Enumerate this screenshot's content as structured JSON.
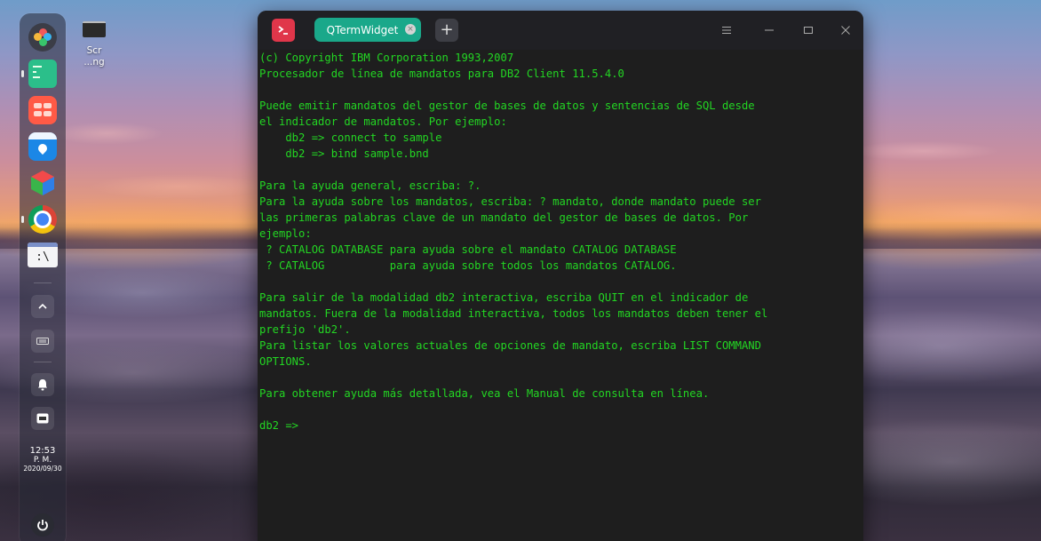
{
  "colors": {
    "terminal_text": "#23d623",
    "terminal_bg": "#1e1e1e",
    "tab_accent": "#1aa88a",
    "app_icon": "#e0364a"
  },
  "dock": {
    "icons": [
      "launcher-icon",
      "terminal-icon",
      "app-store-icon",
      "maps-icon",
      "cube-app-icon",
      "chrome-icon",
      "command-prompt-icon"
    ],
    "clock": {
      "time": "12:53",
      "period": "P. M.",
      "date": "2020/09/30"
    },
    "tray": [
      "chevron-up-icon",
      "keyboard-icon",
      "notification-bell-icon",
      "system-tray-icon"
    ],
    "power_icon": "power-icon"
  },
  "desktop": {
    "file_label_line1": "Scr",
    "file_label_line2": "...ng"
  },
  "window": {
    "app_icon": "terminal-prompt-icon",
    "tab_label": "QTermWidget",
    "new_tab_label": "+",
    "controls": [
      "menu-icon",
      "minimize-icon",
      "maximize-icon",
      "close-icon"
    ]
  },
  "terminal": {
    "lines": [
      "(c) Copyright IBM Corporation 1993,2007",
      "Procesador de línea de mandatos para DB2 Client 11.5.4.0",
      "",
      "Puede emitir mandatos del gestor de bases de datos y sentencias de SQL desde",
      "el indicador de mandatos. Por ejemplo:",
      "    db2 => connect to sample",
      "    db2 => bind sample.bnd",
      "",
      "Para la ayuda general, escriba: ?.",
      "Para la ayuda sobre los mandatos, escriba: ? mandato, donde mandato puede ser",
      "las primeras palabras clave de un mandato del gestor de bases de datos. Por",
      "ejemplo:",
      " ? CATALOG DATABASE para ayuda sobre el mandato CATALOG DATABASE",
      " ? CATALOG          para ayuda sobre todos los mandatos CATALOG.",
      "",
      "Para salir de la modalidad db2 interactiva, escriba QUIT en el indicador de",
      "mandatos. Fuera de la modalidad interactiva, todos los mandatos deben tener el",
      "prefijo 'db2'.",
      "Para listar los valores actuales de opciones de mandato, escriba LIST COMMAND",
      "OPTIONS.",
      "",
      "Para obtener ayuda más detallada, vea el Manual de consulta en línea.",
      "",
      "db2 =>"
    ]
  }
}
